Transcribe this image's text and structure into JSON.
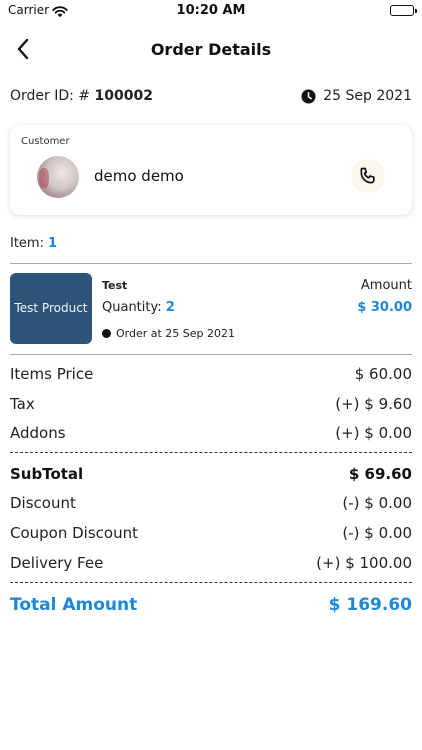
{
  "status_bar": {
    "carrier": "Carrier",
    "time": "10:20 AM"
  },
  "header": {
    "title": "Order Details"
  },
  "order": {
    "id_label": "Order ID: #",
    "id_value": "100002",
    "date": "25 Sep 2021"
  },
  "customer": {
    "label": "Customer",
    "name": "demo demo"
  },
  "items": {
    "label": "Item:",
    "count": "1"
  },
  "product": {
    "thumb_text": "Test Product",
    "name": "Test",
    "quantity_label": "Quantity:",
    "quantity": "2",
    "order_at": "Order at 25 Sep 2021",
    "amount_label": "Amount",
    "amount": "$ 30.00"
  },
  "summary": {
    "items_price_label": "Items Price",
    "items_price": "$ 60.00",
    "tax_label": "Tax",
    "tax": "(+) $ 9.60",
    "addons_label": "Addons",
    "addons": "(+) $ 0.00",
    "subtotal_label": "SubTotal",
    "subtotal": "$ 69.60",
    "discount_label": "Discount",
    "discount": "(-) $ 0.00",
    "coupon_discount_label": "Coupon Discount",
    "coupon_discount": "(-) $ 0.00",
    "delivery_fee_label": "Delivery Fee",
    "delivery_fee": "(+) $ 100.00",
    "total_label": "Total Amount",
    "total": "$ 169.60"
  },
  "colors": {
    "accent": "#1b88d8",
    "product_thumb": "#2e5479",
    "call_button_bg": "#fbf6ec"
  },
  "icons": {
    "back": "chevron-left-icon",
    "clock": "clock-icon",
    "phone": "phone-icon",
    "wifi": "wifi-icon",
    "battery": "battery-icon"
  }
}
